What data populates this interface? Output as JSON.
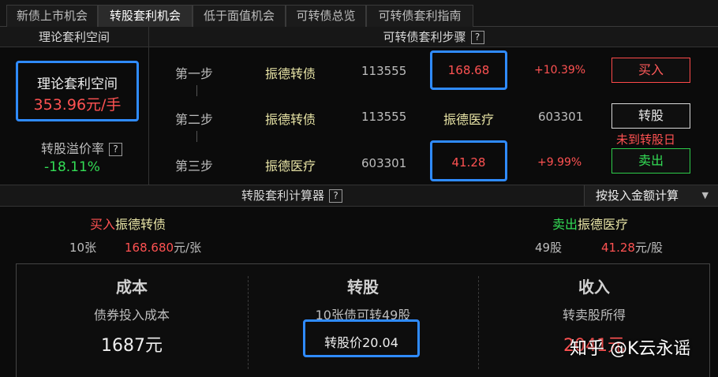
{
  "tabs": [
    {
      "label": "新债上市机会",
      "active": false
    },
    {
      "label": "转股套利机会",
      "active": true
    },
    {
      "label": "低于面值机会",
      "active": false
    },
    {
      "label": "可转债总览",
      "active": false
    },
    {
      "label": "可转债套利指南",
      "active": false
    }
  ],
  "left_panel": {
    "header": "理论套利空间",
    "box_title": "理论套利空间",
    "box_value": "353.96元/手",
    "premium_label": "转股溢价率",
    "premium_help": "?",
    "premium_value": "-18.11%"
  },
  "steps_panel": {
    "header": "可转债套利步骤",
    "help": "?",
    "steps": [
      {
        "step": "第一步",
        "name": "振德转债",
        "code": "113555",
        "price": "168.68",
        "change": "+10.39%",
        "action": "买入"
      },
      {
        "step": "第二步",
        "name": "振德转债",
        "code": "113555",
        "price": "振德医疗",
        "change": "603301",
        "action": "转股",
        "note": "未到转股日"
      },
      {
        "step": "第三步",
        "name": "振德医疗",
        "code": "603301",
        "price": "41.28",
        "change": "+9.99%",
        "action": "卖出"
      }
    ]
  },
  "calculator": {
    "header": "转股套利计算器",
    "help": "?",
    "mode_select": "按投入金额计算",
    "buy_label": "买入",
    "buy_name": "振德转债",
    "buy_qty": "10张",
    "buy_price": "168.680",
    "buy_unit": "元/张",
    "sell_label": "卖出",
    "sell_name": "振德医疗",
    "sell_qty": "49股",
    "sell_price": "41.28",
    "sell_unit": "元/股",
    "cost_title": "成本",
    "cost_sub": "债券投入成本",
    "cost_value": "1687元",
    "convert_title": "转股",
    "convert_sub": "10张债可转49股",
    "convert_value": "转股价20.04",
    "income_title": "收入",
    "income_sub": "转卖股所得",
    "income_value": "2041元"
  },
  "watermark": "知乎 @K云永谣",
  "colors": {
    "highlight_blue": "#2f8bff",
    "up_red": "#ff5252",
    "down_green": "#33dd55",
    "name_yellow": "#e8e4a6"
  }
}
